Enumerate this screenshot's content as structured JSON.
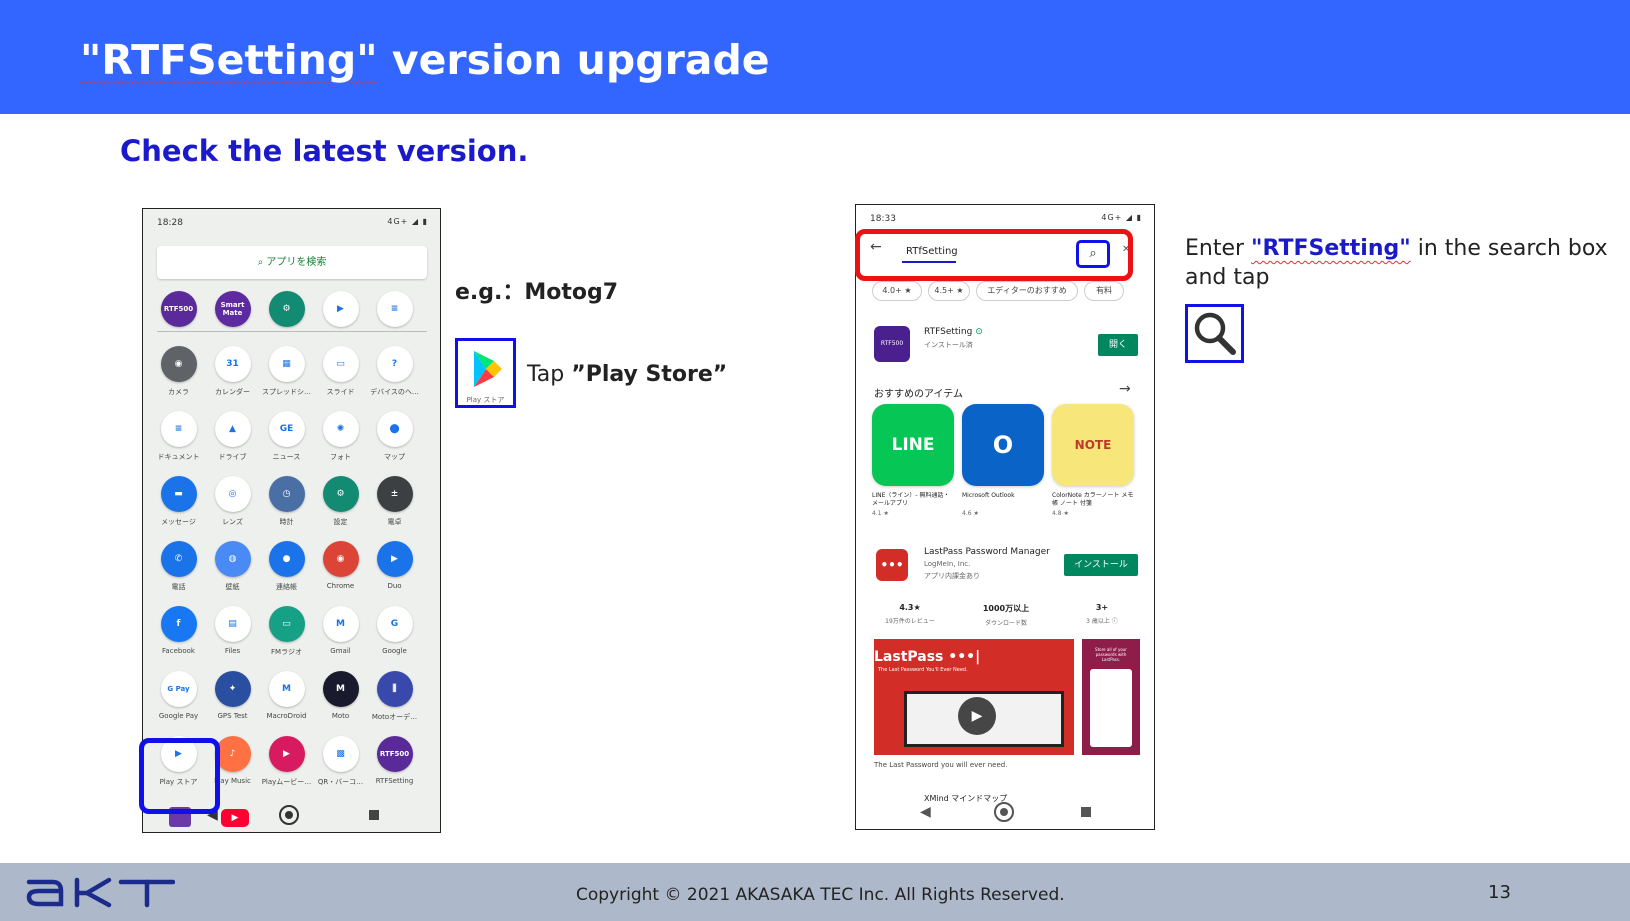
{
  "slide": {
    "title_quoted": "\"RTFSetting\"",
    "title_rest": " version upgrade",
    "subtitle": "Check the latest version.",
    "example_label": "e.g.：Motog7",
    "tap_prefix": "Tap ",
    "tap_target": "”Play Store”",
    "enter_prefix": "Enter ",
    "enter_target": "\"RTFSetting\"",
    "enter_suffix": " in the search box and tap",
    "play_store_icon_label": "Play ストア",
    "copyright": "Copyright © 2021 AKASAKA TEC Inc. All Rights Reserved.",
    "page_number": "13",
    "logo_text": "AKT"
  },
  "colors": {
    "header_bg": "#3366ff",
    "subtitle": "#1a1acc",
    "highlight_blue": "#1010e8",
    "highlight_red": "#ee1111",
    "footer_bg": "#adb9ca",
    "store_green": "#01875f"
  },
  "phone1": {
    "time": "18:28",
    "status_icons": "4G+",
    "search_placeholder": "アプリを検索",
    "dock_row": [
      {
        "label": "",
        "icon": "rtf500-icon",
        "text": "RTF500",
        "color": "#5a2a9a"
      },
      {
        "label": "",
        "icon": "smartmate-icon",
        "text": "Smart Mate",
        "color": "#5e2aa0"
      },
      {
        "label": "",
        "icon": "settings-icon",
        "text": "⚙",
        "color": "#138a72"
      },
      {
        "label": "",
        "icon": "play-store-icon",
        "text": "▶",
        "color": "#ffffff"
      },
      {
        "label": "",
        "icon": "docs-icon",
        "text": "≡",
        "color": "#ffffff"
      }
    ],
    "app_rows": [
      [
        {
          "label": "カメラ",
          "icon": "camera-icon",
          "text": "◉",
          "color": "#5f6368"
        },
        {
          "label": "カレンダー",
          "icon": "calendar-icon",
          "text": "31",
          "color": "#ffffff"
        },
        {
          "label": "スプレッドシ…",
          "icon": "sheets-icon",
          "text": "▦",
          "color": "#ffffff"
        },
        {
          "label": "スライド",
          "icon": "slides-icon",
          "text": "▭",
          "color": "#ffffff"
        },
        {
          "label": "デバイスのヘ…",
          "icon": "help-icon",
          "text": "?",
          "color": "#ffffff"
        }
      ],
      [
        {
          "label": "ドキュメント",
          "icon": "docs-icon",
          "text": "≡",
          "color": "#ffffff"
        },
        {
          "label": "ドライブ",
          "icon": "drive-icon",
          "text": "▲",
          "color": "#ffffff"
        },
        {
          "label": "ニュース",
          "icon": "news-icon",
          "text": "GE",
          "color": "#ffffff"
        },
        {
          "label": "フォト",
          "icon": "photos-icon",
          "text": "✺",
          "color": "#ffffff"
        },
        {
          "label": "マップ",
          "icon": "maps-icon",
          "text": "⬤",
          "color": "#ffffff"
        }
      ],
      [
        {
          "label": "メッセージ",
          "icon": "messages-icon",
          "text": "▬",
          "color": "#1a73e8"
        },
        {
          "label": "レンズ",
          "icon": "lens-icon",
          "text": "◎",
          "color": "#ffffff"
        },
        {
          "label": "時計",
          "icon": "clock-icon",
          "text": "◷",
          "color": "#4a6fa5"
        },
        {
          "label": "設定",
          "icon": "settings-icon",
          "text": "⚙",
          "color": "#138a72"
        },
        {
          "label": "電卓",
          "icon": "calculator-icon",
          "text": "±",
          "color": "#3c4043"
        }
      ],
      [
        {
          "label": "電話",
          "icon": "phone-icon",
          "text": "✆",
          "color": "#1a73e8"
        },
        {
          "label": "壁紙",
          "icon": "wallpaper-icon",
          "text": "◍",
          "color": "#4a8af4"
        },
        {
          "label": "連絡帳",
          "icon": "contacts-icon",
          "text": "●",
          "color": "#1a73e8"
        },
        {
          "label": "Chrome",
          "icon": "chrome-icon",
          "text": "◉",
          "color": "#db4437"
        },
        {
          "label": "Duo",
          "icon": "duo-icon",
          "text": "▶",
          "color": "#1a73e8"
        }
      ],
      [
        {
          "label": "Facebook",
          "icon": "facebook-icon",
          "text": "f",
          "color": "#1877f2"
        },
        {
          "label": "Files",
          "icon": "files-icon",
          "text": "▤",
          "color": "#ffffff"
        },
        {
          "label": "FMラジオ",
          "icon": "fm-radio-icon",
          "text": "▭",
          "color": "#16a085"
        },
        {
          "label": "Gmail",
          "icon": "gmail-icon",
          "text": "M",
          "color": "#ffffff"
        },
        {
          "label": "Google",
          "icon": "google-icon",
          "text": "G",
          "color": "#ffffff"
        }
      ],
      [
        {
          "label": "Google Pay",
          "icon": "google-pay-icon",
          "text": "G Pay",
          "color": "#ffffff"
        },
        {
          "label": "GPS Test",
          "icon": "gps-test-icon",
          "text": "✦",
          "color": "#2a4ea0"
        },
        {
          "label": "MacroDroid",
          "icon": "macrodroid-icon",
          "text": "M",
          "color": "#ffffff"
        },
        {
          "label": "Moto",
          "icon": "moto-icon",
          "text": "M",
          "color": "#1a1a2e"
        },
        {
          "label": "Motoオーデ…",
          "icon": "moto-audio-icon",
          "text": "⫼",
          "color": "#3949ab"
        }
      ],
      [
        {
          "label": "Play ストア",
          "icon": "play-store-icon",
          "text": "▶",
          "color": "#ffffff"
        },
        {
          "label": "Play Music",
          "icon": "play-music-icon",
          "text": "♪",
          "color": "#ff7043"
        },
        {
          "label": "Playムービー…",
          "icon": "play-movies-icon",
          "text": "▶",
          "color": "#d81b60"
        },
        {
          "label": "QR・バーコ…",
          "icon": "qr-code-icon",
          "text": "▩",
          "color": "#ffffff"
        },
        {
          "label": "RTFSetting",
          "icon": "rtf500-icon",
          "text": "RTF500",
          "color": "#5a2a9a"
        }
      ]
    ]
  },
  "phone2": {
    "time": "18:33",
    "status_icons": "4G+",
    "search_value": "RTfSetting",
    "filter_chips": [
      "4.0+ ★",
      "4.5+ ★",
      "エディターのおすすめ",
      "有料"
    ],
    "result_app_name": "RTFSetting",
    "result_app_status": "インストール済",
    "result_app_icon_text": "RTF500",
    "open_button": "開く",
    "recommended_title": "おすすめのアイテム",
    "recommended": [
      {
        "name": "LINE（ライン）- 無料通話・メールアプリ",
        "rating": "4.1 ★",
        "icon": "line-icon",
        "text": "LINE",
        "color": "#06c755"
      },
      {
        "name": "Microsoft Outlook",
        "rating": "4.6 ★",
        "icon": "outlook-icon",
        "text": "O",
        "color": "#0a64c8"
      },
      {
        "name": "ColorNote カラーノート メモ帳 ノート 付箋",
        "rating": "4.8 ★",
        "icon": "colornote-icon",
        "text": "NOTE",
        "color": "#f7e67a"
      }
    ],
    "ad_app_name": "LastPass Password Manager",
    "ad_developer": "LogMeIn, Inc.",
    "ad_iap": "アプリ内課金あり",
    "install_button": "インストール",
    "stats": [
      {
        "value": "4.3★",
        "label": "19万件のレビュー"
      },
      {
        "value": "1000万以上",
        "label": "ダウンロード数"
      },
      {
        "value": "3+",
        "label": "3 歳以上 ⓘ"
      }
    ],
    "promo_brand": "LastPass •••|",
    "promo_tagline": "The Last Password You'll Ever Need.",
    "promo_side_text": "Store all of your passwords with LastPass.",
    "promo_caption": "The Last Password you will ever need.",
    "next_app": "XMind マインドマップ"
  }
}
